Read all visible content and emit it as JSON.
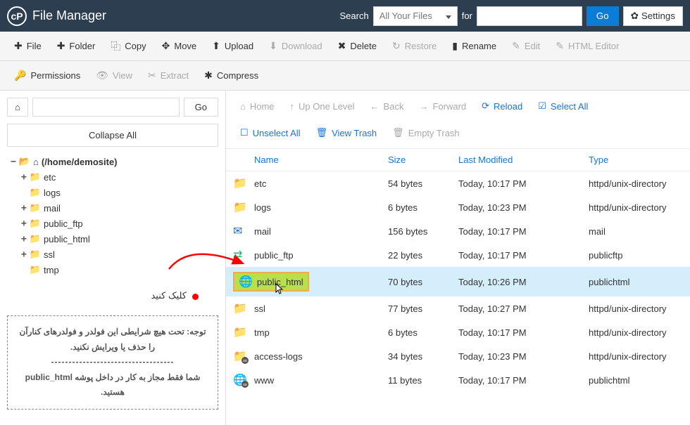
{
  "header": {
    "app_title": "File Manager",
    "search_label": "Search",
    "search_select": "All Your Files",
    "for_label": "for",
    "go_label": "Go",
    "settings_label": "Settings"
  },
  "toolbar": {
    "file": "File",
    "folder": "Folder",
    "copy": "Copy",
    "move": "Move",
    "upload": "Upload",
    "download": "Download",
    "delete": "Delete",
    "restore": "Restore",
    "rename": "Rename",
    "edit": "Edit",
    "html_editor": "HTML Editor",
    "permissions": "Permissions",
    "view": "View",
    "extract": "Extract",
    "compress": "Compress"
  },
  "sidebar": {
    "go": "Go",
    "collapse": "Collapse All",
    "root": "(/home/demosite)",
    "tree": [
      "etc",
      "logs",
      "mail",
      "public_ftp",
      "public_html",
      "ssl",
      "tmp"
    ],
    "click_text": "کلیک کنید",
    "note_line1": "توجه: تحت هیچ شرایطی این فولدر و فولدرهای کنارآن را حذف یا ویرایش نکنید.",
    "note_hr": "-----------------------------------",
    "note_line2": "شما فقط مجاز به کار در داخل پوشه public_html هستید."
  },
  "content_toolbar": {
    "home": "Home",
    "up": "Up One Level",
    "back": "Back",
    "forward": "Forward",
    "reload": "Reload",
    "select_all": "Select All",
    "unselect_all": "Unselect All",
    "view_trash": "View Trash",
    "empty_trash": "Empty Trash"
  },
  "table": {
    "headers": {
      "name": "Name",
      "size": "Size",
      "modified": "Last Modified",
      "type": "Type"
    },
    "rows": [
      {
        "name": "etc",
        "size": "54 bytes",
        "modified": "Today, 10:17 PM",
        "type": "httpd/unix-directory",
        "icon": "folder"
      },
      {
        "name": "logs",
        "size": "6 bytes",
        "modified": "Today, 10:23 PM",
        "type": "httpd/unix-directory",
        "icon": "folder"
      },
      {
        "name": "mail",
        "size": "156 bytes",
        "modified": "Today, 10:17 PM",
        "type": "mail",
        "icon": "mail"
      },
      {
        "name": "public_ftp",
        "size": "22 bytes",
        "modified": "Today, 10:17 PM",
        "type": "publicftp",
        "icon": "transfer"
      },
      {
        "name": "public_html",
        "size": "70 bytes",
        "modified": "Today, 10:26 PM",
        "type": "publichtml",
        "icon": "globe",
        "highlight": true
      },
      {
        "name": "ssl",
        "size": "77 bytes",
        "modified": "Today, 10:27 PM",
        "type": "httpd/unix-directory",
        "icon": "folder"
      },
      {
        "name": "tmp",
        "size": "6 bytes",
        "modified": "Today, 10:17 PM",
        "type": "httpd/unix-directory",
        "icon": "folder"
      },
      {
        "name": "access-logs",
        "size": "34 bytes",
        "modified": "Today, 10:23 PM",
        "type": "httpd/unix-directory",
        "icon": "folder-link"
      },
      {
        "name": "www",
        "size": "11 bytes",
        "modified": "Today, 10:17 PM",
        "type": "publichtml",
        "icon": "globe-link"
      }
    ]
  }
}
